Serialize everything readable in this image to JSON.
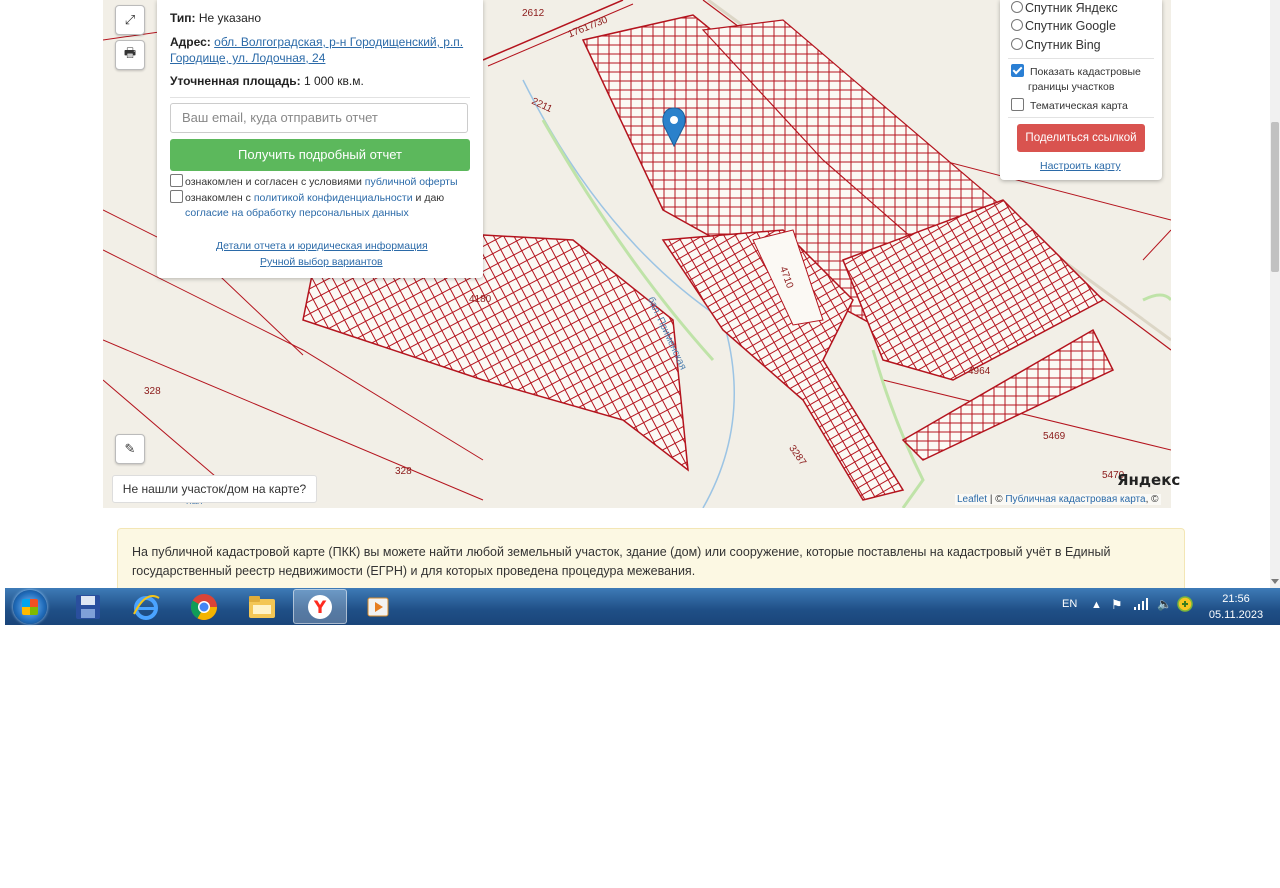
{
  "map": {
    "controls": {
      "fullscreen_icon": "expand-icon",
      "print_icon": "printer-icon",
      "ruler_icon": "ruler-icon"
    },
    "labels": [
      "2612",
      "17617/30",
      "2211",
      "4180",
      "4710",
      "328",
      "328",
      "4964",
      "5469",
      "5470",
      "3287",
      "бал. Применская",
      "ная"
    ],
    "marker": {
      "color": "#2a81cb",
      "icon": "map-marker-icon"
    },
    "cadastral_color": "#b4141e",
    "not_found_label": "Не нашли участок/дом на карте?",
    "attribution": {
      "leaflet": "Leaflet",
      "separator": "| ©",
      "pkk": "Публичная кадастровая карта",
      "tail": ", ©"
    },
    "yandex_logo": "Яндекс"
  },
  "info": {
    "type_label": "Тип:",
    "type_value": "Не указано",
    "address_label": "Адрес:",
    "address_line1": "обл. Волгоградская, р-н Городищенский, р.п.",
    "address_line2": "Городище, ул. Лодочная, 24",
    "area_label": "Уточненная площадь:",
    "area_value": "1 000 кв.м.",
    "email_placeholder": "Ваш email, куда отправить отчет",
    "report_button": "Получить подробный отчет",
    "agree1_text": "ознакомлен и согласен с условиями",
    "agree1_link": "публичной оферты",
    "agree2_text": "ознакомлен с",
    "agree2_link": "политикой конфиденциальности",
    "agree2_mid": "и даю",
    "agree2_link2": "согласие на обработку персональных данных",
    "details_link": "Детали отчета и юридическая информация",
    "manual_link": "Ручной выбор вариантов"
  },
  "layers": {
    "radios": [
      "Спутник Яндекс",
      "Спутник Google",
      "Спутник Bing"
    ],
    "show_borders": "Показать кадастровые",
    "show_borders2": "границы участков",
    "show_borders_checked": true,
    "thematic": "Тематическая карта",
    "thematic_checked": false,
    "share_button": "Поделиться ссылкой",
    "configure_link": "Настроить карту"
  },
  "notice": {
    "text": "На публичной кадастровой карте (ПКК) вы можете найти любой земельный участок, здание (дом) или сооружение, которые поставлены на кадастровый учёт в Единый государственный реестр недвижимости (ЕГРН) и для которых проведена процедура межевания."
  },
  "taskbar": {
    "apps": [
      "windows-start-icon",
      "floppy-disk-icon",
      "internet-explorer-icon",
      "chrome-icon",
      "file-explorer-icon",
      "yandex-browser-icon",
      "media-player-icon"
    ],
    "lang": "EN",
    "time": "21:56",
    "date": "05.11.2023"
  }
}
